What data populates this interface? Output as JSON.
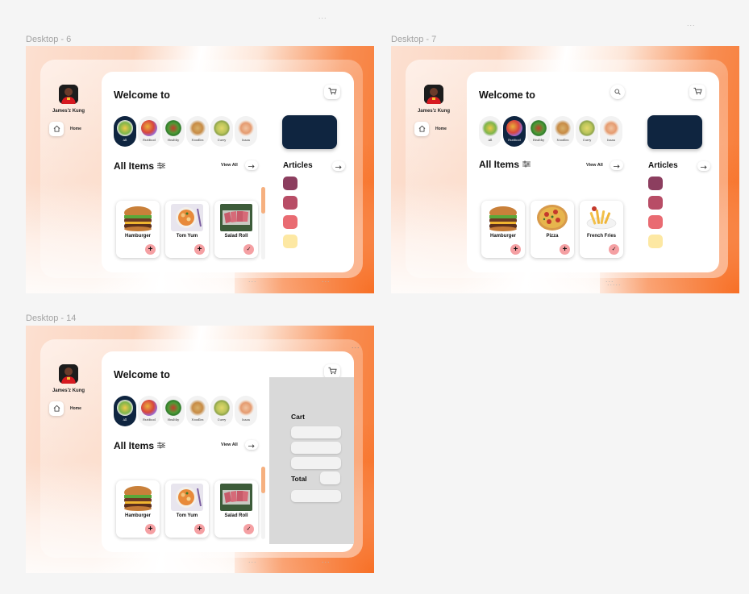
{
  "canvas": {
    "top_dots": "...",
    "top_right_dots": "..."
  },
  "frames": [
    {
      "label": "Desktop - 6",
      "user": {
        "name": "James'z Kung",
        "nav_home": "Home"
      },
      "welcome": "Welcome to",
      "categories": [
        {
          "label": "All",
          "active": true
        },
        {
          "label": "Fastfood",
          "active": false
        },
        {
          "label": "Healthy",
          "active": false
        },
        {
          "label": "Noodles",
          "active": false
        },
        {
          "label": "Curry",
          "active": false
        },
        {
          "label": "Isaan",
          "active": false
        }
      ],
      "all_items": "All Items",
      "view_all": "View All",
      "articles": "Articles",
      "article_swatches": [
        "#8c3e5f",
        "#b84d66",
        "#e96b72",
        "#fde8a3"
      ],
      "foods": [
        {
          "name": "Hamburger",
          "action": "+"
        },
        {
          "name": "Tom Yum",
          "action": "+"
        },
        {
          "name": "Salad Roll",
          "action": "✓"
        }
      ],
      "bottom_dots": "...",
      "bottom_dots_2": "..."
    },
    {
      "label": "Desktop - 7",
      "user": {
        "name": "James'z Kung",
        "nav_home": "Home"
      },
      "welcome": "Welcome to",
      "categories": [
        {
          "label": "All",
          "active": false
        },
        {
          "label": "Fastfood",
          "active": true
        },
        {
          "label": "Healthy",
          "active": false
        },
        {
          "label": "Noodles",
          "active": false
        },
        {
          "label": "Curry",
          "active": false
        },
        {
          "label": "Isaan",
          "active": false
        }
      ],
      "all_items": "All Items",
      "view_all": "View All",
      "articles": "Articles",
      "article_swatches": [
        "#8c3e5f",
        "#b84d66",
        "#e96b72",
        "#fde8a3"
      ],
      "foods": [
        {
          "name": "Hamburger",
          "action": "+"
        },
        {
          "name": "Pizza",
          "action": "+"
        },
        {
          "name": "French Fries",
          "action": "✓"
        }
      ],
      "bottom_dots": "...",
      "bottom_dots_2": "....."
    },
    {
      "label": "Desktop - 14",
      "user": {
        "name": "James'z Kung",
        "nav_home": "Home"
      },
      "welcome": "Welcome to",
      "categories": [
        {
          "label": "All",
          "active": true
        },
        {
          "label": "Fastfood",
          "active": false
        },
        {
          "label": "Healthy",
          "active": false
        },
        {
          "label": "Noodles",
          "active": false
        },
        {
          "label": "Curry",
          "active": false
        },
        {
          "label": "Isaan",
          "active": false
        }
      ],
      "all_items": "All Items",
      "view_all": "View All",
      "foods": [
        {
          "name": "Hamburger",
          "action": "+"
        },
        {
          "name": "Tom Yum",
          "action": "+"
        },
        {
          "name": "Salad Roll",
          "action": "✓"
        }
      ],
      "cart": {
        "title": "Cart",
        "total_label": "Total"
      },
      "top_dots": "...",
      "bottom_dots": "...",
      "bottom_dots_2": "..."
    }
  ],
  "colors": {
    "accent_orange": "#f7772f",
    "navy": "#0f2540",
    "pink_button": "#f5a0a3",
    "cart_panel": "#d9d9d9"
  }
}
